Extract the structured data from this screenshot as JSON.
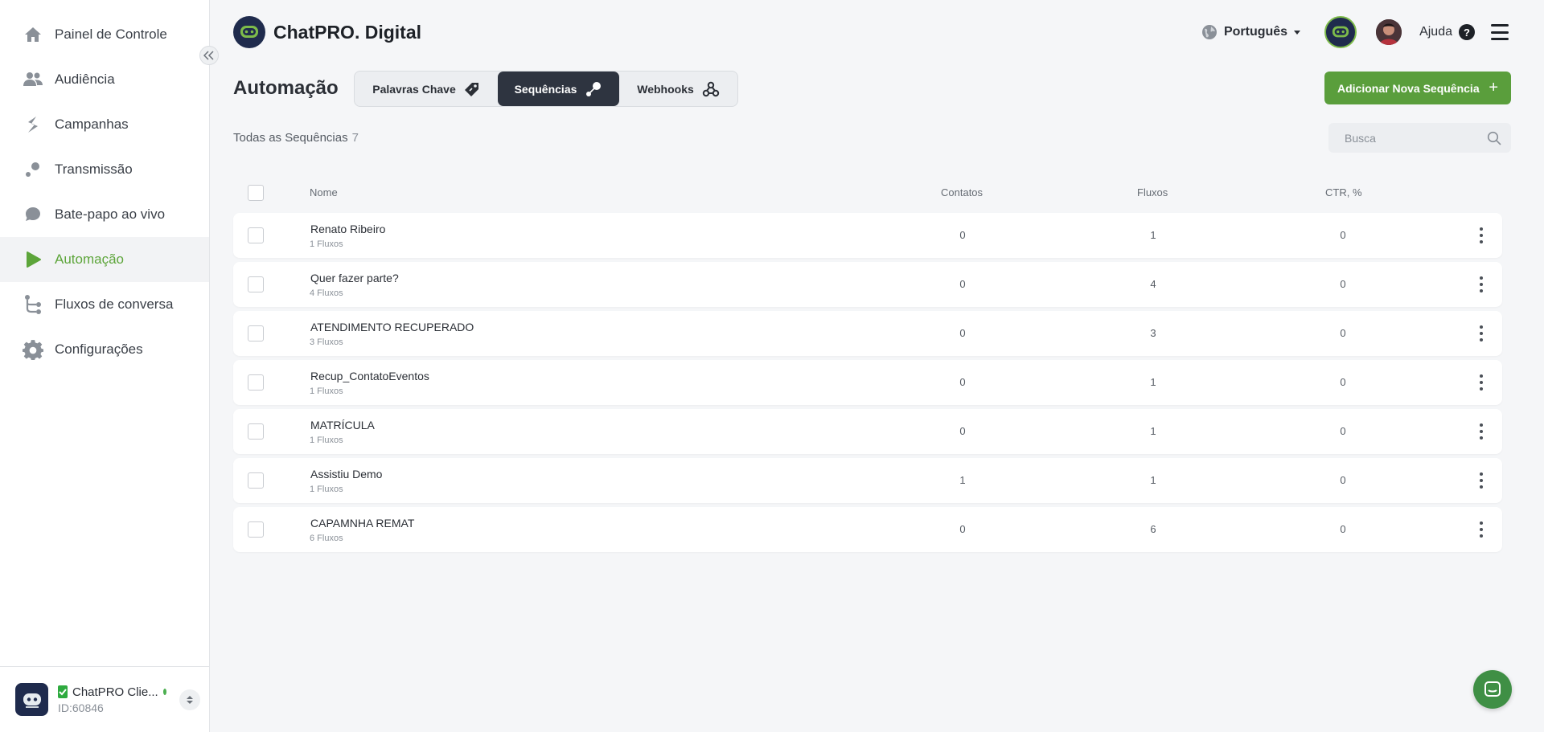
{
  "sidebar": {
    "items": [
      {
        "label": "Painel de Controle",
        "icon": "home-icon"
      },
      {
        "label": "Audiência",
        "icon": "people-icon"
      },
      {
        "label": "Campanhas",
        "icon": "campaign-icon"
      },
      {
        "label": "Transmissão",
        "icon": "broadcast-icon"
      },
      {
        "label": "Bate-papo ao vivo",
        "icon": "chat-bubble-icon"
      },
      {
        "label": "Automação",
        "icon": "play-icon",
        "active": true
      },
      {
        "label": "Fluxos de conversa",
        "icon": "flow-icon"
      },
      {
        "label": "Configurações",
        "icon": "gear-icon"
      }
    ],
    "account": {
      "name": "ChatPRO Clie...",
      "id": "ID:60846"
    }
  },
  "header": {
    "brand": "ChatPRO. Digital",
    "language": "Português",
    "help": "Ajuda"
  },
  "page": {
    "title": "Automação",
    "tabs": [
      {
        "label": "Palavras Chave",
        "icon": "tag-icon"
      },
      {
        "label": "Sequências",
        "icon": "sequence-icon",
        "active": true
      },
      {
        "label": "Webhooks",
        "icon": "webhook-icon"
      }
    ],
    "add_button": "Adicionar Nova Sequência",
    "list_label": "Todas as Sequências",
    "list_count": "7",
    "search_placeholder": "Busca"
  },
  "table": {
    "columns": {
      "name": "Nome",
      "contacts": "Contatos",
      "flows": "Fluxos",
      "ctr": "CTR, %"
    },
    "rows": [
      {
        "name": "Renato Ribeiro",
        "sub": "1 Fluxos",
        "contacts": "0",
        "flows": "1",
        "ctr": "0"
      },
      {
        "name": "Quer fazer parte?",
        "sub": "4 Fluxos",
        "contacts": "0",
        "flows": "4",
        "ctr": "0"
      },
      {
        "name": "ATENDIMENTO RECUPERADO",
        "sub": "3 Fluxos",
        "contacts": "0",
        "flows": "3",
        "ctr": "0"
      },
      {
        "name": "Recup_ContatoEventos",
        "sub": "1 Fluxos",
        "contacts": "0",
        "flows": "1",
        "ctr": "0"
      },
      {
        "name": "MATRÍCULA",
        "sub": "1 Fluxos",
        "contacts": "0",
        "flows": "1",
        "ctr": "0"
      },
      {
        "name": "Assistiu Demo",
        "sub": "1 Fluxos",
        "contacts": "1",
        "flows": "1",
        "ctr": "0"
      },
      {
        "name": "CAPAMNHA REMAT",
        "sub": "6 Fluxos",
        "contacts": "0",
        "flows": "6",
        "ctr": "0"
      }
    ]
  },
  "colors": {
    "accent": "#5da53a",
    "button": "#5a9e3c",
    "active_tab": "#2e3440",
    "brand_dark": "#1f2b4d"
  }
}
